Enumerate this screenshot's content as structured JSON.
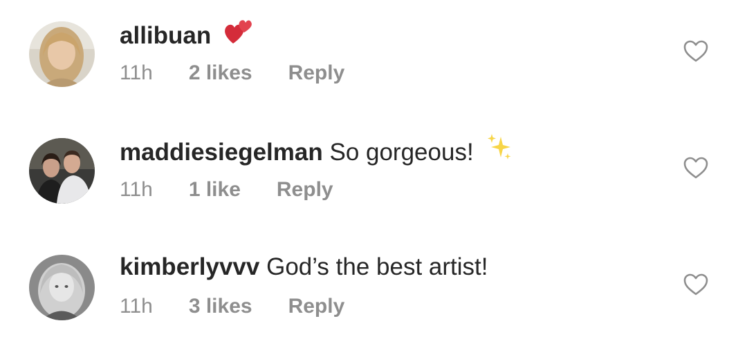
{
  "comments": [
    {
      "username": "allibuan",
      "text": "",
      "emoji": "two-hearts-emoji",
      "time": "11h",
      "likes": "2 likes",
      "reply": "Reply",
      "avatar": "blonde-woman-avatar"
    },
    {
      "username": "maddiesiegelman",
      "text": "So gorgeous!",
      "emoji": "sparkles-emoji",
      "time": "11h",
      "likes": "1 like",
      "reply": "Reply",
      "avatar": "couple-avatar"
    },
    {
      "username": "kimberlyvvv",
      "text": "God’s the best artist!",
      "emoji": "",
      "time": "11h",
      "likes": "3 likes",
      "reply": "Reply",
      "avatar": "grayscale-woman-avatar"
    }
  ],
  "colors": {
    "primary_text": "#262626",
    "secondary_text": "#8e8e8e",
    "heart_outline": "#8e8e8e",
    "background": "#ffffff"
  },
  "icons": {
    "like": "heart-outline-icon"
  }
}
